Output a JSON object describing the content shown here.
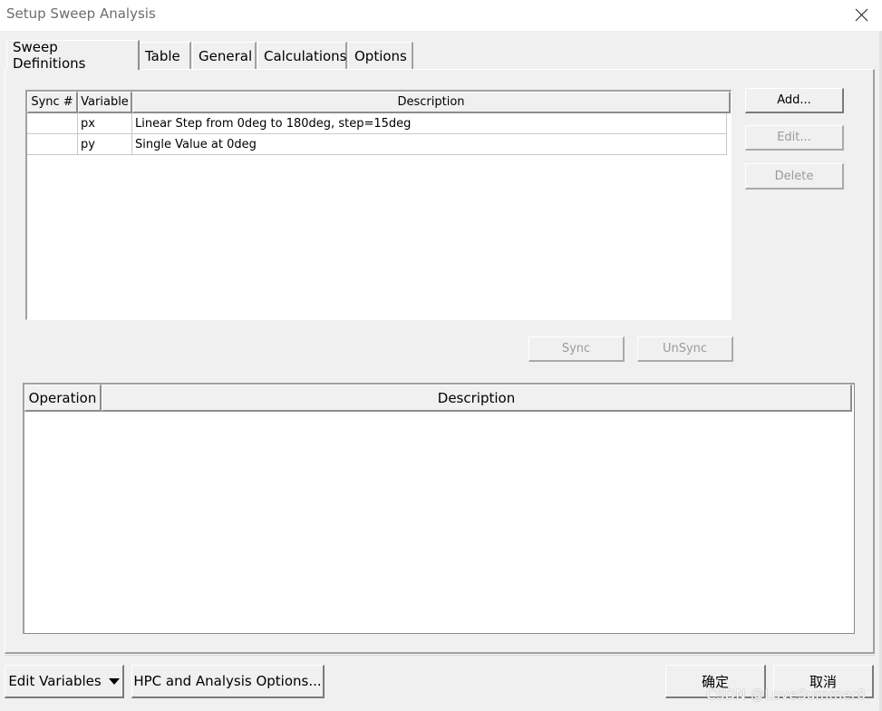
{
  "window": {
    "title": "Setup Sweep Analysis"
  },
  "tabs": [
    {
      "label": "Sweep Definitions",
      "active": true
    },
    {
      "label": "Table",
      "active": false
    },
    {
      "label": "General",
      "active": false
    },
    {
      "label": "Calculations",
      "active": false
    },
    {
      "label": "Options",
      "active": false
    }
  ],
  "sweep_table": {
    "columns": [
      "Sync #",
      "Variable",
      "Description"
    ],
    "rows": [
      {
        "sync": "",
        "variable": "px",
        "description": "Linear Step from 0deg to 180deg, step=15deg"
      },
      {
        "sync": "",
        "variable": "py",
        "description": "Single Value at 0deg"
      }
    ]
  },
  "side_buttons": {
    "add": "Add...",
    "edit": "Edit...",
    "delete": "Delete"
  },
  "sync_buttons": {
    "sync": "Sync",
    "unsync": "UnSync"
  },
  "operation_table": {
    "columns": [
      "Operation",
      "Description"
    ]
  },
  "footer": {
    "edit_variables": "Edit Variables",
    "hpc_options": "HPC and Analysis Options...",
    "ok": "确定",
    "cancel": "取消"
  },
  "watermark": "CSDN @LoveSummer8",
  "icons": {
    "close": "close-icon",
    "dropdown": "caret-down-icon"
  }
}
